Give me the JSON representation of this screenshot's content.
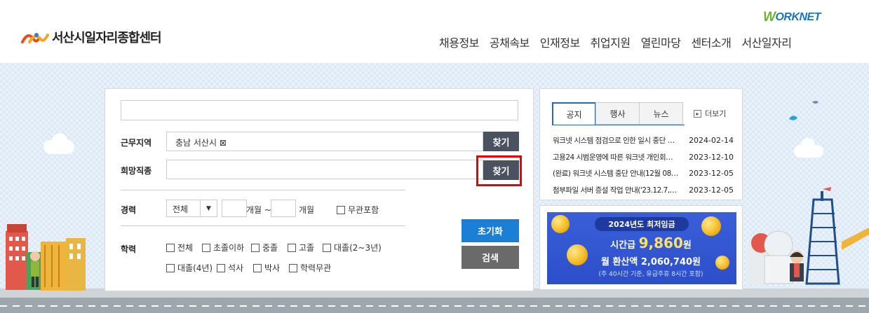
{
  "header": {
    "logo_text": "서산시일자리종합센터",
    "worknet_w": "W",
    "worknet_rest": "ORKNET",
    "nav": [
      "채용정보",
      "공채속보",
      "인재정보",
      "취업지원",
      "열린마당",
      "센터소개",
      "서산일자리"
    ]
  },
  "search": {
    "keyword_value": "",
    "region_label": "근무지역",
    "region_value": "충남 서산시 ⊠",
    "region_find": "찾기",
    "job_label": "희망직종",
    "job_value": "",
    "job_find": "찾기",
    "career_label": "경력",
    "career_select": "전체",
    "months_sep": "개월 ~",
    "months_end": "개월",
    "career_any": "무관포함",
    "edu_label": "학력",
    "edu_options": [
      "전체",
      "초졸이하",
      "중졸",
      "고졸",
      "대졸(2~3년)",
      "대졸(4년)",
      "석사",
      "박사",
      "학력무관"
    ],
    "reset_button": "초기화",
    "search_button": "검색"
  },
  "notice": {
    "tabs": [
      "공지",
      "행사",
      "뉴스"
    ],
    "active_tab": 0,
    "more": "더보기",
    "items": [
      {
        "title": "워크넷 시스템 점검으로 인한 일시 중단 안...",
        "date": "2024-02-14"
      },
      {
        "title": "고용24 시범운영에 따른 워크넷 개인회원 ...",
        "date": "2023-12-10"
      },
      {
        "title": "(완료) 워크넷 시스템 중단 안내(12월 08일...",
        "date": "2023-12-05"
      },
      {
        "title": "첨부파일 서버 증설 작업 안내('23.12.7, 01:...",
        "date": "2023-12-05"
      }
    ]
  },
  "banner": {
    "top": "2024년도 최저임금",
    "hourly_prefix": "시간급",
    "hourly_value": "9,860",
    "hourly_unit": "원",
    "monthly": "월 환산액 2,060,740원",
    "note": "(주 40시간 기준, 유급주휴 8시간 포함)"
  },
  "colors": {
    "find_button": "#4a5262",
    "reset_button": "#1a7fd5",
    "search_button": "#6a6a6a",
    "highlight": "#ee0000",
    "tab_active": "#2a65b7"
  }
}
